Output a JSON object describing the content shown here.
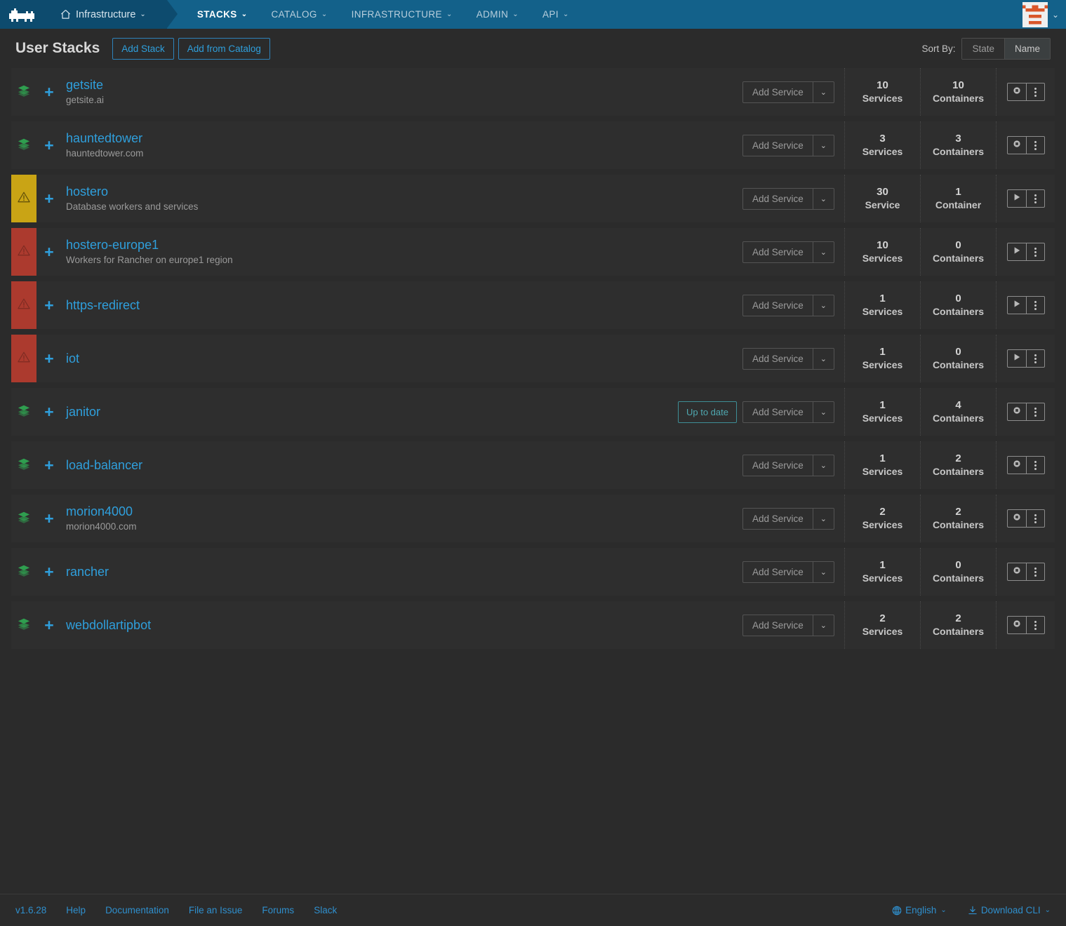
{
  "topnav": {
    "logo_icon": "rancher-cow-logo",
    "environment": {
      "label": "Infrastructure",
      "icon": "home-icon",
      "caret": "⌄"
    },
    "items": [
      {
        "label": "STACKS",
        "caret": "⌄",
        "active": true
      },
      {
        "label": "CATALOG",
        "caret": "⌄",
        "active": false
      },
      {
        "label": "INFRASTRUCTURE",
        "caret": "⌄",
        "active": false
      },
      {
        "label": "ADMIN",
        "caret": "⌄",
        "active": false
      },
      {
        "label": "API",
        "caret": "⌄",
        "active": false
      }
    ],
    "avatar_icon": "user-avatar-identicon",
    "avatar_caret": "⌄"
  },
  "header": {
    "title": "User Stacks",
    "add_stack_label": "Add Stack",
    "add_from_catalog_label": "Add from Catalog",
    "sort_label": "Sort By:",
    "sort_options": [
      "State",
      "Name"
    ],
    "sort_selected": "Name"
  },
  "labels": {
    "add_service": "Add Service",
    "add_service_caret": "⌄",
    "up_to_date": "Up to date",
    "plus": "+"
  },
  "colors": {
    "accent_blue": "#2f9fdc",
    "nav_blue": "#13618a",
    "nav_blue_dark": "#0d4b6e",
    "state_warning": "#c9a415",
    "state_error": "#ac3a2e",
    "state_healthy": "#2f9e4f",
    "row_bg": "#2e2e2e",
    "page_bg": "#2b2b2b",
    "badge_teal": "#4fa8b0"
  },
  "stacks": [
    {
      "name": "getsite",
      "desc": "getsite.ai",
      "state": "ok",
      "state_icon": "stack-layers-icon",
      "services_count": "10",
      "services_label": "Services",
      "containers_count": "10",
      "containers_label": "Containers",
      "action_icon": "stop-icon",
      "badge": null
    },
    {
      "name": "hauntedtower",
      "desc": "hauntedtower.com",
      "state": "ok",
      "state_icon": "stack-layers-icon",
      "services_count": "3",
      "services_label": "Services",
      "containers_count": "3",
      "containers_label": "Containers",
      "action_icon": "stop-icon",
      "badge": null
    },
    {
      "name": "hostero",
      "desc": "Database workers and services",
      "state": "warn",
      "state_icon": "warning-triangle-icon",
      "services_count": "30",
      "services_label": "Service",
      "containers_count": "1",
      "containers_label": "Container",
      "action_icon": "play-icon",
      "badge": null
    },
    {
      "name": "hostero-europe1",
      "desc": "Workers for Rancher on europe1 region",
      "state": "error",
      "state_icon": "warning-triangle-icon",
      "services_count": "10",
      "services_label": "Services",
      "containers_count": "0",
      "containers_label": "Containers",
      "action_icon": "play-icon",
      "badge": null
    },
    {
      "name": "https-redirect",
      "desc": "",
      "state": "error",
      "state_icon": "warning-triangle-icon",
      "services_count": "1",
      "services_label": "Services",
      "containers_count": "0",
      "containers_label": "Containers",
      "action_icon": "play-icon",
      "badge": null
    },
    {
      "name": "iot",
      "desc": "",
      "state": "error",
      "state_icon": "warning-triangle-icon",
      "services_count": "1",
      "services_label": "Services",
      "containers_count": "0",
      "containers_label": "Containers",
      "action_icon": "play-icon",
      "badge": null
    },
    {
      "name": "janitor",
      "desc": "",
      "state": "ok",
      "state_icon": "stack-layers-icon",
      "services_count": "1",
      "services_label": "Services",
      "containers_count": "4",
      "containers_label": "Containers",
      "action_icon": "stop-icon",
      "badge": "Up to date"
    },
    {
      "name": "load-balancer",
      "desc": "",
      "state": "ok",
      "state_icon": "stack-layers-icon",
      "services_count": "1",
      "services_label": "Services",
      "containers_count": "2",
      "containers_label": "Containers",
      "action_icon": "stop-icon",
      "badge": null
    },
    {
      "name": "morion4000",
      "desc": "morion4000.com",
      "state": "ok",
      "state_icon": "stack-layers-icon",
      "services_count": "2",
      "services_label": "Services",
      "containers_count": "2",
      "containers_label": "Containers",
      "action_icon": "stop-icon",
      "badge": null
    },
    {
      "name": "rancher",
      "desc": "",
      "state": "ok",
      "state_icon": "stack-layers-icon",
      "services_count": "1",
      "services_label": "Services",
      "containers_count": "0",
      "containers_label": "Containers",
      "action_icon": "stop-icon",
      "badge": null
    },
    {
      "name": "webdollartipbot",
      "desc": "",
      "state": "ok",
      "state_icon": "stack-layers-icon",
      "services_count": "2",
      "services_label": "Services",
      "containers_count": "2",
      "containers_label": "Containers",
      "action_icon": "stop-icon",
      "badge": null
    }
  ],
  "footer": {
    "version": "v1.6.28",
    "links": [
      "Help",
      "Documentation",
      "File an Issue",
      "Forums",
      "Slack"
    ],
    "language": {
      "label": "English",
      "icon": "globe-icon",
      "caret": "⌄"
    },
    "download_cli": {
      "label": "Download CLI",
      "icon": "download-icon",
      "caret": "⌄"
    }
  }
}
